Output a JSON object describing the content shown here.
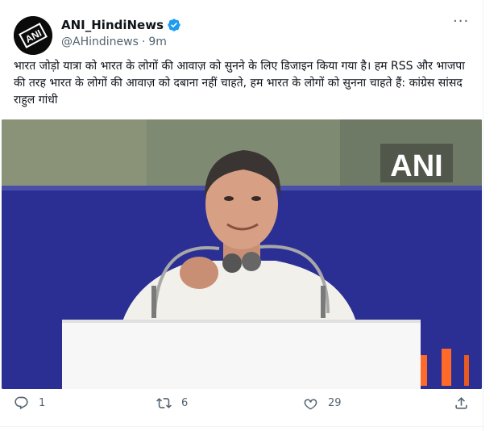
{
  "tweet": {
    "display_name": "ANI_HindiNews",
    "handle": "@AHindinews",
    "separator": "·",
    "time": "9m",
    "text": "भारत जोड़ो यात्रा को भारत के लोगों की आवाज़ को सुनने के लिए डिजाइन किया गया है। हम RSS और भाजपा की तरह भारत के लोगों की आवाज़ को दबाना नहीं चाहते, हम भारत के लोगों को सुनना चाहते हैं: कांग्रेस सांसद राहुल गांधी",
    "more_label": "···",
    "avatar_logo": "ANI",
    "media_watermark": "ANI"
  },
  "actions": {
    "reply_count": "1",
    "retweet_count": "6",
    "like_count": "29"
  },
  "colors": {
    "verified": "#1d9bf0",
    "text_secondary": "#536471",
    "backdrop_blue": "#2a2f96"
  }
}
